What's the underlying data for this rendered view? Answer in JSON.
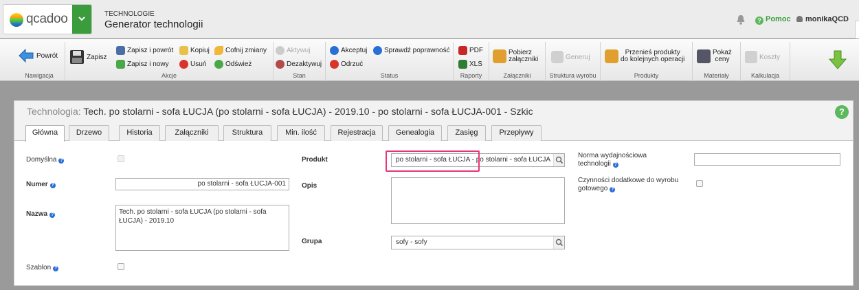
{
  "header": {
    "logo_text": "qcadoo",
    "module": "TECHNOLOGIE",
    "page_name": "Generator technologii",
    "help": "Pomoc",
    "user": "monikaQCD"
  },
  "ribbon": {
    "nav": {
      "back": "Powrót",
      "label": "Nawigacja"
    },
    "actions": {
      "save": "Zapisz",
      "save_back": "Zapisz i powrót",
      "save_new": "Zapisz i nowy",
      "copy": "Kopiuj",
      "delete": "Usuń",
      "undo": "Cofnij zmiany",
      "refresh": "Odśwież",
      "label": "Akcje"
    },
    "state": {
      "activate": "Aktywuj",
      "deactivate": "Dezaktywuj",
      "label": "Stan"
    },
    "status": {
      "accept": "Akceptuj",
      "check": "Sprawdź poprawność",
      "reject": "Odrzuć",
      "label": "Status"
    },
    "reports": {
      "pdf": "PDF",
      "xls": "XLS",
      "label": "Raporty"
    },
    "attachments": {
      "download_1": "Pobierz",
      "download_2": "załączniki",
      "label": "Załączniki"
    },
    "structure": {
      "generate": "Generuj",
      "label": "Struktura wyrobu"
    },
    "products": {
      "move_1": "Przenieś produkty",
      "move_2": "do kolejnych operacji",
      "label": "Produkty"
    },
    "materials": {
      "show_price_1": "Pokaż",
      "show_price_2": "ceny",
      "label": "Materiały"
    },
    "costing": {
      "costs": "Koszty",
      "label": "Kalkulacja"
    }
  },
  "panel": {
    "title_label": "Technologia:",
    "title_value": "Tech. po stolarni - sofa ŁUCJA (po stolarni - sofa ŁUCJA) - 2019.10 - po stolarni - sofa ŁUCJA-001 - Szkic",
    "help": "?"
  },
  "tabs": [
    "Główna",
    "Drzewo",
    "Historia",
    "Załączniki",
    "Struktura",
    "Min. ilość",
    "Rejestracja",
    "Genealogia",
    "Zasięg",
    "Przepływy"
  ],
  "form": {
    "default_label": "Domyślna",
    "number_label": "Numer",
    "number_value": "po stolarni - sofa ŁUCJA-001",
    "name_label": "Nazwa",
    "name_value": "Tech. po stolarni - sofa ŁUCJA (po stolarni - sofa ŁUCJA) - 2019.10",
    "template_label": "Szablon",
    "product_label": "Produkt",
    "product_value": "po stolarni - sofa ŁUCJA - po stolarni - sofa ŁUCJA",
    "desc_label": "Opis",
    "desc_value": "",
    "group_label": "Grupa",
    "group_value": "sofy - sofy",
    "norm_label_1": "Norma wydajnościowa",
    "norm_label_2": "technologii",
    "norm_value": "",
    "extra_label_1": "Czynności dodatkowe do wyrobu",
    "extra_label_2": "gotowego"
  },
  "colors": {
    "accent_green": "#3a9c3a",
    "info_blue": "#2a6fd6",
    "highlight": "#e8357a"
  }
}
